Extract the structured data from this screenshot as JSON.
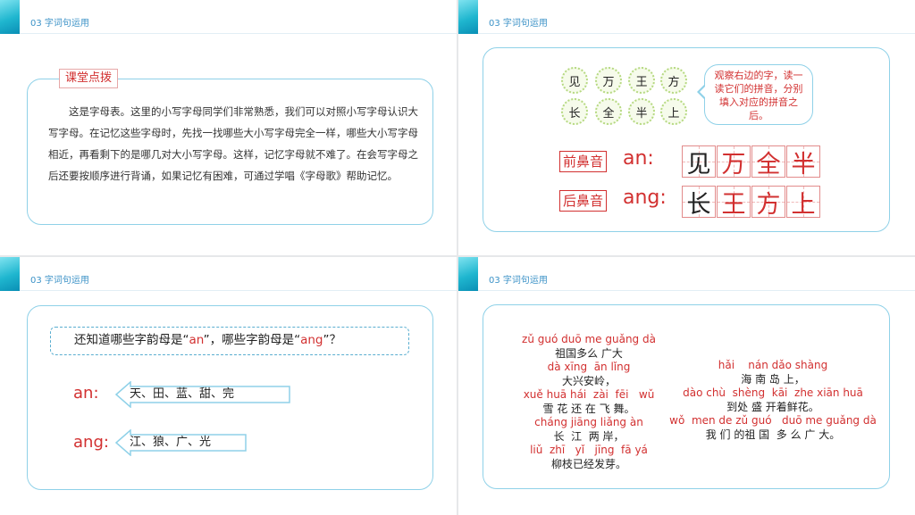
{
  "section_header": "03 字词句运用",
  "slide1": {
    "tag": "课堂点拨",
    "paragraph": "这是字母表。这里的小写字母同学们非常熟悉，我们可以对照小写字母认识大写字母。在记忆这些字母时，先找一找哪些大小写字母完全一样，哪些大小写字母相近，再看剩下的是哪几对大小写字母。这样，记忆字母就不难了。在会写字母之后还要按顺序进行背诵，如果记忆有困难，可通过学唱《字母歌》帮助记忆。"
  },
  "slide2": {
    "circle_chars": [
      "见",
      "万",
      "王",
      "方",
      "长",
      "全",
      "半",
      "上"
    ],
    "bubble": "观察右边的字，读一读它们的拼音，分别填入对应的拼音之后。",
    "rows": [
      {
        "label": "前鼻音",
        "pinyin": "an:",
        "chars": [
          "见",
          "万",
          "全",
          "半"
        ],
        "char_colors": [
          "#222222",
          "#d23030",
          "#d23030",
          "#d23030"
        ]
      },
      {
        "label": "后鼻音",
        "pinyin": "ang:",
        "chars": [
          "长",
          "王",
          "方",
          "上"
        ],
        "char_colors": [
          "#222222",
          "#d23030",
          "#d23030",
          "#d23030"
        ]
      }
    ]
  },
  "slide3": {
    "question_a": "还知道哪些字韵母是“",
    "question_b": "an",
    "question_c": "”，哪些字韵母是“",
    "question_d": "ang",
    "question_e": "”？",
    "rows": [
      {
        "label": "an:",
        "words": "天、田、蓝、甜、完"
      },
      {
        "label": "ang:",
        "words": "江、狼、广、光"
      }
    ]
  },
  "slide4": {
    "poem_left": [
      {
        "pinyin": "zǔ guó duō me guǎng dà",
        "hanzi": "祖国多么 广大"
      },
      {
        "pinyin": "dà xīng  ān lǐng",
        "hanzi": "大兴安岭，"
      },
      {
        "pinyin": "xuě huā hái  zài  fēi   wǔ",
        "hanzi": "雪 花 还 在 飞 舞。"
      },
      {
        "pinyin": "cháng jiāng liǎng àn",
        "hanzi": "长  江  两 岸，"
      },
      {
        "pinyin": "liǔ  zhī   yǐ   jīng  fā yá",
        "hanzi": "柳枝已经发芽。"
      }
    ],
    "poem_right": [
      {
        "pinyin": "hǎi    nán dǎo shàng",
        "hanzi": "海 南 岛 上，"
      },
      {
        "pinyin": "dào chù  shèng  kāi  zhe xiān huā",
        "hanzi": "到处 盛 开着鲜花。"
      },
      {
        "pinyin": "wǒ  men de zǔ guó   duō me guǎng dà",
        "hanzi": "我 们 的祖 国  多 么 广 大。"
      }
    ]
  }
}
